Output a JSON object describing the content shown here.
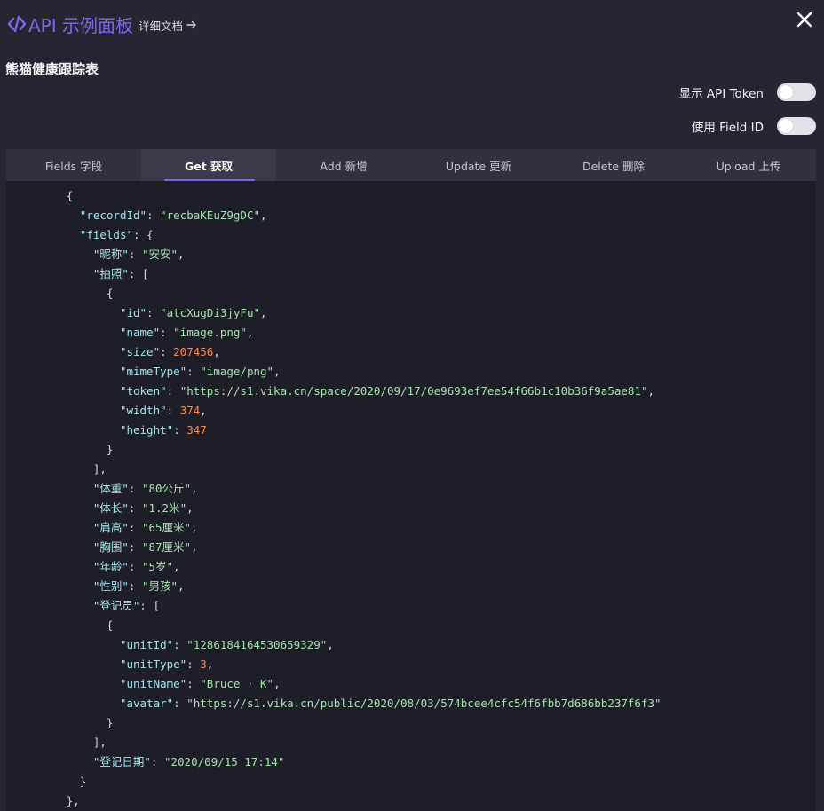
{
  "panel": {
    "title": "API 示例面板",
    "doc_link": "详细文档",
    "datasheet_title": "熊猫健康跟踪表"
  },
  "toggles": [
    {
      "label": "显示 API Token",
      "on": false
    },
    {
      "label": "使用 Field ID",
      "on": false
    }
  ],
  "tabs": [
    {
      "label": "Fields 字段",
      "active": false
    },
    {
      "label": "Get 获取",
      "active": true
    },
    {
      "label": "Add 新增",
      "active": false
    },
    {
      "label": "Update 更新",
      "active": false
    },
    {
      "label": "Delete 删除",
      "active": false
    },
    {
      "label": "Upload 上传",
      "active": false
    }
  ],
  "colors": {
    "accent": "#7b67ee",
    "key": "#a6e3e9",
    "string": "#a8e0b2",
    "number": "#f28b54"
  },
  "code_lines": [
    [
      {
        "t": "p",
        "v": "{"
      }
    ],
    [
      {
        "t": "k",
        "v": "\"recordId\""
      },
      {
        "t": "p",
        "v": ": "
      },
      {
        "t": "s",
        "v": "\"recbaKEuZ9gDC\""
      },
      {
        "t": "p",
        "v": ","
      }
    ],
    [
      {
        "t": "k",
        "v": "\"fields\""
      },
      {
        "t": "p",
        "v": ": {"
      }
    ],
    [
      {
        "t": "k",
        "v": "\"昵称\""
      },
      {
        "t": "p",
        "v": ": "
      },
      {
        "t": "s",
        "v": "\"安安\""
      },
      {
        "t": "p",
        "v": ","
      }
    ],
    [
      {
        "t": "k",
        "v": "\"拍照\""
      },
      {
        "t": "p",
        "v": ": ["
      }
    ],
    [
      {
        "t": "p",
        "v": "{"
      }
    ],
    [
      {
        "t": "k",
        "v": "\"id\""
      },
      {
        "t": "p",
        "v": ": "
      },
      {
        "t": "s",
        "v": "\"atcXugDi3jyFu\""
      },
      {
        "t": "p",
        "v": ","
      }
    ],
    [
      {
        "t": "k",
        "v": "\"name\""
      },
      {
        "t": "p",
        "v": ": "
      },
      {
        "t": "s",
        "v": "\"image.png\""
      },
      {
        "t": "p",
        "v": ","
      }
    ],
    [
      {
        "t": "k",
        "v": "\"size\""
      },
      {
        "t": "p",
        "v": ": "
      },
      {
        "t": "n",
        "v": "207456"
      },
      {
        "t": "p",
        "v": ","
      }
    ],
    [
      {
        "t": "k",
        "v": "\"mimeType\""
      },
      {
        "t": "p",
        "v": ": "
      },
      {
        "t": "s",
        "v": "\"image/png\""
      },
      {
        "t": "p",
        "v": ","
      }
    ],
    [
      {
        "t": "k",
        "v": "\"token\""
      },
      {
        "t": "p",
        "v": ": "
      },
      {
        "t": "s",
        "v": "\"https://s1.vika.cn/space/2020/09/17/0e9693ef7ee54f66b1c10b36f9a5ae81\""
      },
      {
        "t": "p",
        "v": ","
      }
    ],
    [
      {
        "t": "k",
        "v": "\"width\""
      },
      {
        "t": "p",
        "v": ": "
      },
      {
        "t": "n",
        "v": "374"
      },
      {
        "t": "p",
        "v": ","
      }
    ],
    [
      {
        "t": "k",
        "v": "\"height\""
      },
      {
        "t": "p",
        "v": ": "
      },
      {
        "t": "n",
        "v": "347"
      }
    ],
    [
      {
        "t": "p",
        "v": "}"
      }
    ],
    [
      {
        "t": "p",
        "v": "],"
      }
    ],
    [
      {
        "t": "k",
        "v": "\"体重\""
      },
      {
        "t": "p",
        "v": ": "
      },
      {
        "t": "s",
        "v": "\"80公斤\""
      },
      {
        "t": "p",
        "v": ","
      }
    ],
    [
      {
        "t": "k",
        "v": "\"体长\""
      },
      {
        "t": "p",
        "v": ": "
      },
      {
        "t": "s",
        "v": "\"1.2米\""
      },
      {
        "t": "p",
        "v": ","
      }
    ],
    [
      {
        "t": "k",
        "v": "\"肩高\""
      },
      {
        "t": "p",
        "v": ": "
      },
      {
        "t": "s",
        "v": "\"65厘米\""
      },
      {
        "t": "p",
        "v": ","
      }
    ],
    [
      {
        "t": "k",
        "v": "\"胸围\""
      },
      {
        "t": "p",
        "v": ": "
      },
      {
        "t": "s",
        "v": "\"87厘米\""
      },
      {
        "t": "p",
        "v": ","
      }
    ],
    [
      {
        "t": "k",
        "v": "\"年龄\""
      },
      {
        "t": "p",
        "v": ": "
      },
      {
        "t": "s",
        "v": "\"5岁\""
      },
      {
        "t": "p",
        "v": ","
      }
    ],
    [
      {
        "t": "k",
        "v": "\"性别\""
      },
      {
        "t": "p",
        "v": ": "
      },
      {
        "t": "s",
        "v": "\"男孩\""
      },
      {
        "t": "p",
        "v": ","
      }
    ],
    [
      {
        "t": "k",
        "v": "\"登记员\""
      },
      {
        "t": "p",
        "v": ": ["
      }
    ],
    [
      {
        "t": "p",
        "v": "{"
      }
    ],
    [
      {
        "t": "k",
        "v": "\"unitId\""
      },
      {
        "t": "p",
        "v": ": "
      },
      {
        "t": "s",
        "v": "\"1286184164530659329\""
      },
      {
        "t": "p",
        "v": ","
      }
    ],
    [
      {
        "t": "k",
        "v": "\"unitType\""
      },
      {
        "t": "p",
        "v": ": "
      },
      {
        "t": "n",
        "v": "3"
      },
      {
        "t": "p",
        "v": ","
      }
    ],
    [
      {
        "t": "k",
        "v": "\"unitName\""
      },
      {
        "t": "p",
        "v": ": "
      },
      {
        "t": "s",
        "v": "\"Bruce · K\""
      },
      {
        "t": "p",
        "v": ","
      }
    ],
    [
      {
        "t": "k",
        "v": "\"avatar\""
      },
      {
        "t": "p",
        "v": ": "
      },
      {
        "t": "s",
        "v": "\"https://s1.vika.cn/public/2020/08/03/574bcee4cfc54f6fbb7d686bb237f6f3\""
      }
    ],
    [
      {
        "t": "p",
        "v": "}"
      }
    ],
    [
      {
        "t": "p",
        "v": "],"
      }
    ],
    [
      {
        "t": "k",
        "v": "\"登记日期\""
      },
      {
        "t": "p",
        "v": ": "
      },
      {
        "t": "s",
        "v": "\"2020/09/15 17:14\""
      }
    ],
    [
      {
        "t": "p",
        "v": "}"
      }
    ],
    [
      {
        "t": "p",
        "v": "},"
      }
    ]
  ]
}
